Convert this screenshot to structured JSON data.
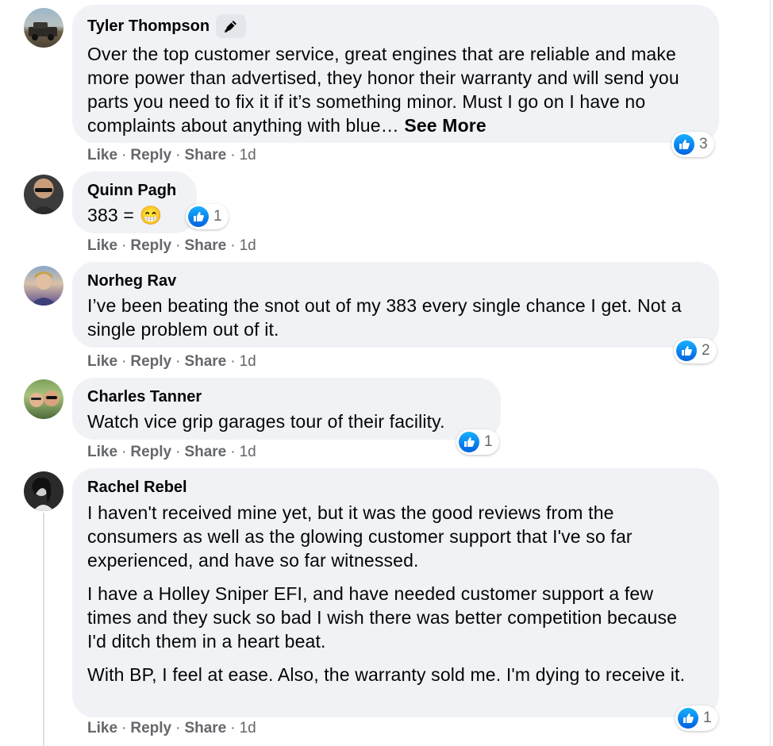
{
  "comments": [
    {
      "author": "Tyler Thompson",
      "text_lines": [
        "Over the top customer service, great engines that are reliable and make more power than advertised, they honor their warranty and will send you parts you need to fix it if it’s something minor. Must I go on I have no complaints about anything with blue…"
      ],
      "see_more": "See More",
      "badge_icon": "top-fan-pencil-icon",
      "reaction_count": "3",
      "like": "Like",
      "reply": "Reply",
      "share": "Share",
      "time": "1d"
    },
    {
      "author": "Quinn Pagh",
      "text": "383 = 😁",
      "reaction_count": "1",
      "like": "Like",
      "reply": "Reply",
      "share": "Share",
      "time": "1d"
    },
    {
      "author": "Norheg Rav",
      "text": "I’ve been beating the snot out of my 383 every single chance I get. Not a single problem out of it.",
      "reaction_count": "2",
      "like": "Like",
      "reply": "Reply",
      "share": "Share",
      "time": "1d"
    },
    {
      "author": "Charles Tanner",
      "text": "Watch vice grip garages tour of their facility.",
      "reaction_count": "1",
      "like": "Like",
      "reply": "Reply",
      "share": "Share",
      "time": "1d"
    },
    {
      "author": "Rachel Rebel",
      "paragraphs": [
        "I haven't received mine yet, but it was the good reviews from the consumers as well as the glowing customer support that I've so far experienced, and have so far witnessed.",
        "I have a Holley Sniper EFI, and have needed customer support a few times and they suck so bad I wish there was better competition because I'd ditch them in a heart beat.",
        "With BP, I feel at ease. Also, the warranty sold me. I'm dying to receive it."
      ],
      "reaction_count": "1",
      "like": "Like",
      "reply": "Reply",
      "share": "Share",
      "time": "1d"
    }
  ],
  "colors": {
    "bubble": "#f0f2f5",
    "meta": "#65676b",
    "like_blue": "#1877f2"
  },
  "separator": "·"
}
